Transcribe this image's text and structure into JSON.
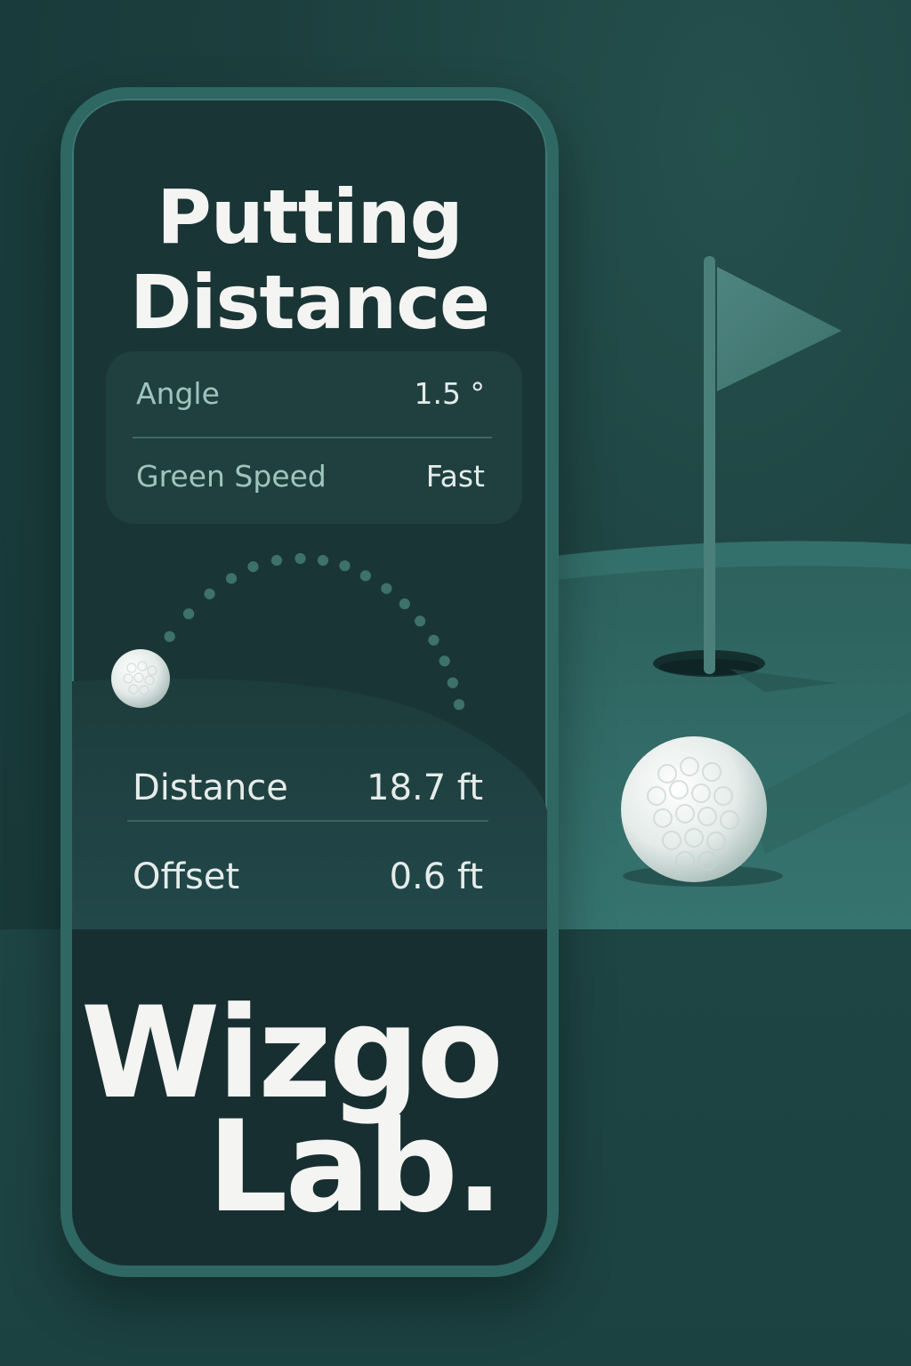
{
  "app": {
    "title_line1": "Putting",
    "title_line2": "Distance"
  },
  "settings": {
    "angle_label": "Angle",
    "angle_value": "1.5 °",
    "speed_label": "Green Speed",
    "speed_value": "Fast"
  },
  "results": {
    "distance_label": "Distance",
    "distance_value": "18.7 ft",
    "offset_label": "Offset",
    "offset_value": "0.6 ft"
  },
  "brand": {
    "line1": "Wizgo",
    "line2": "Lab."
  },
  "colors": {
    "background": "#1c3f3e",
    "green_surface": "#2f6b67",
    "phone_frame": "#2f6763",
    "text_primary": "#f4f4f2",
    "text_muted": "#9fc4c0"
  }
}
